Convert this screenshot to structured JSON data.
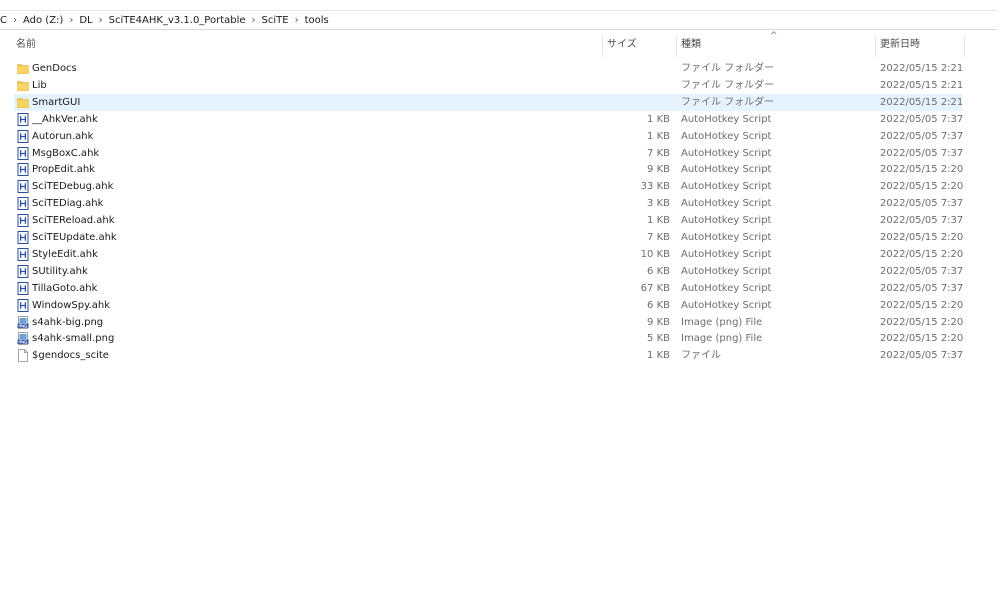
{
  "breadcrumb": [
    {
      "label": "C"
    },
    {
      "label": "Ado (Z:)"
    },
    {
      "label": "DL"
    },
    {
      "label": "SciTE4AHK_v3.1.0_Portable"
    },
    {
      "label": "SciTE"
    },
    {
      "label": "tools"
    }
  ],
  "breadcrumb_separator": "›",
  "columns": {
    "name": "名前",
    "size": "サイズ",
    "type": "種類",
    "date": "更新日時"
  },
  "sort_indicator": "^",
  "files": [
    {
      "name": "GenDocs",
      "size": "",
      "type": "ファイル フォルダー",
      "date": "2022/05/15 2:21",
      "icon": "folder-icon",
      "selected": false
    },
    {
      "name": "Lib",
      "size": "",
      "type": "ファイル フォルダー",
      "date": "2022/05/15 2:21",
      "icon": "folder-icon",
      "selected": false
    },
    {
      "name": "SmartGUI",
      "size": "",
      "type": "ファイル フォルダー",
      "date": "2022/05/15 2:21",
      "icon": "folder-icon",
      "selected": true
    },
    {
      "name": "__AhkVer.ahk",
      "size": "1 KB",
      "type": "AutoHotkey Script",
      "date": "2022/05/05 7:37",
      "icon": "ahk-script-icon",
      "selected": false
    },
    {
      "name": "Autorun.ahk",
      "size": "1 KB",
      "type": "AutoHotkey Script",
      "date": "2022/05/05 7:37",
      "icon": "ahk-script-icon",
      "selected": false
    },
    {
      "name": "MsgBoxC.ahk",
      "size": "7 KB",
      "type": "AutoHotkey Script",
      "date": "2022/05/05 7:37",
      "icon": "ahk-script-icon",
      "selected": false
    },
    {
      "name": "PropEdit.ahk",
      "size": "9 KB",
      "type": "AutoHotkey Script",
      "date": "2022/05/15 2:20",
      "icon": "ahk-script-icon",
      "selected": false
    },
    {
      "name": "SciTEDebug.ahk",
      "size": "33 KB",
      "type": "AutoHotkey Script",
      "date": "2022/05/15 2:20",
      "icon": "ahk-script-icon",
      "selected": false
    },
    {
      "name": "SciTEDiag.ahk",
      "size": "3 KB",
      "type": "AutoHotkey Script",
      "date": "2022/05/05 7:37",
      "icon": "ahk-script-icon",
      "selected": false
    },
    {
      "name": "SciTEReload.ahk",
      "size": "1 KB",
      "type": "AutoHotkey Script",
      "date": "2022/05/05 7:37",
      "icon": "ahk-script-icon",
      "selected": false
    },
    {
      "name": "SciTEUpdate.ahk",
      "size": "7 KB",
      "type": "AutoHotkey Script",
      "date": "2022/05/15 2:20",
      "icon": "ahk-script-icon",
      "selected": false
    },
    {
      "name": "StyleEdit.ahk",
      "size": "10 KB",
      "type": "AutoHotkey Script",
      "date": "2022/05/15 2:20",
      "icon": "ahk-script-icon",
      "selected": false
    },
    {
      "name": "SUtility.ahk",
      "size": "6 KB",
      "type": "AutoHotkey Script",
      "date": "2022/05/05 7:37",
      "icon": "ahk-script-icon",
      "selected": false
    },
    {
      "name": "TillaGoto.ahk",
      "size": "67 KB",
      "type": "AutoHotkey Script",
      "date": "2022/05/05 7:37",
      "icon": "ahk-script-icon",
      "selected": false
    },
    {
      "name": "WindowSpy.ahk",
      "size": "6 KB",
      "type": "AutoHotkey Script",
      "date": "2022/05/15 2:20",
      "icon": "ahk-script-icon",
      "selected": false
    },
    {
      "name": "s4ahk-big.png",
      "size": "9 KB",
      "type": "Image (png) File",
      "date": "2022/05/15 2:20",
      "icon": "png-image-icon",
      "selected": false
    },
    {
      "name": "s4ahk-small.png",
      "size": "5 KB",
      "type": "Image (png) File",
      "date": "2022/05/15 2:20",
      "icon": "png-image-icon",
      "selected": false
    },
    {
      "name": "$gendocs_scite",
      "size": "1 KB",
      "type": "ファイル",
      "date": "2022/05/05 7:37",
      "icon": "blank-file-icon",
      "selected": false
    }
  ],
  "colors": {
    "selection": "#e5f3ff",
    "folder": "#f0c24b",
    "ahk_icon": "#2b4f9e"
  }
}
